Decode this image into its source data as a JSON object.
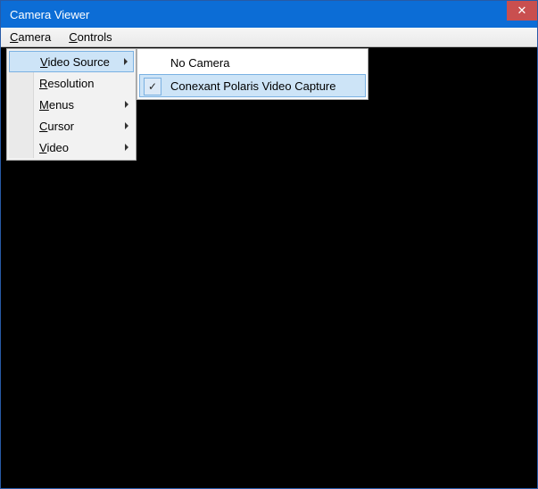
{
  "window": {
    "title": "Camera Viewer",
    "close_glyph": "✕"
  },
  "menubar": {
    "items": [
      {
        "label": "Camera",
        "accel": "C"
      },
      {
        "label": "Controls",
        "accel": "C"
      }
    ]
  },
  "camera_menu": {
    "items": [
      {
        "label": "Video Source",
        "accel": "V",
        "has_submenu": true,
        "selected": true
      },
      {
        "label": "Resolution",
        "accel": "R",
        "has_submenu": false
      },
      {
        "label": "Menus",
        "accel": "M",
        "has_submenu": true
      },
      {
        "label": "Cursor",
        "accel": "C",
        "has_submenu": true
      },
      {
        "label": "Video",
        "accel": "V",
        "has_submenu": true
      }
    ]
  },
  "video_source_submenu": {
    "items": [
      {
        "label": "No Camera",
        "checked": false,
        "selected": false
      },
      {
        "label": "Conexant Polaris Video Capture",
        "checked": true,
        "selected": true
      }
    ]
  },
  "colors": {
    "titlebar": "#0c6dd6",
    "close": "#c94f4f",
    "highlight_bg": "#cde4f7",
    "highlight_border": "#7ab1e2"
  }
}
